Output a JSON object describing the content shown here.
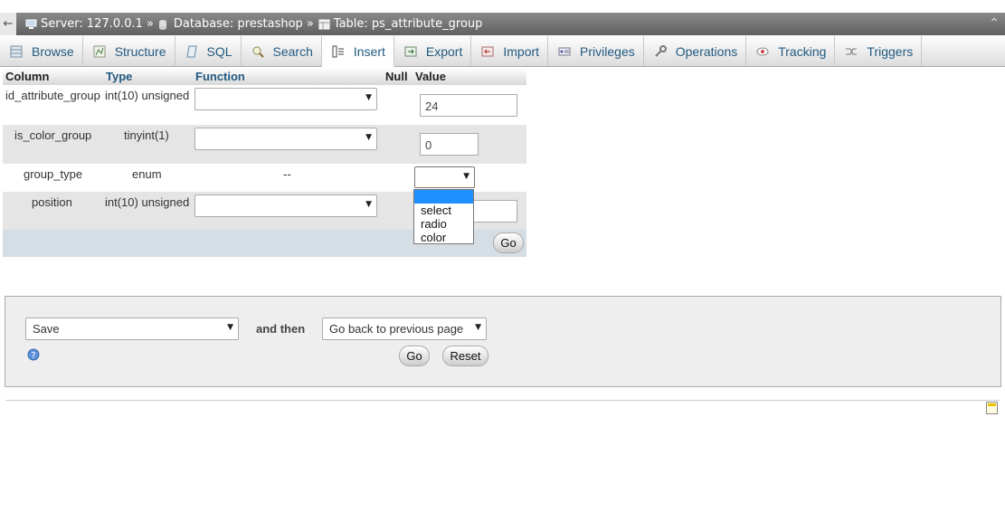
{
  "breadcrumb": {
    "back": "←",
    "server": "Server: 127.0.0.1",
    "database": "Database: prestashop",
    "table": "Table: ps_attribute_group",
    "separator": "»",
    "collapse": "⌃"
  },
  "tabs": [
    {
      "label": "Browse",
      "icon": "browse-icon"
    },
    {
      "label": "Structure",
      "icon": "structure-icon"
    },
    {
      "label": "SQL",
      "icon": "sql-icon"
    },
    {
      "label": "Search",
      "icon": "search-icon"
    },
    {
      "label": "Insert",
      "icon": "insert-icon",
      "active": true
    },
    {
      "label": "Export",
      "icon": "export-icon"
    },
    {
      "label": "Import",
      "icon": "import-icon"
    },
    {
      "label": "Privileges",
      "icon": "privileges-icon"
    },
    {
      "label": "Operations",
      "icon": "operations-icon"
    },
    {
      "label": "Tracking",
      "icon": "tracking-icon"
    },
    {
      "label": "Triggers",
      "icon": "triggers-icon"
    }
  ],
  "insert_table": {
    "headers": {
      "column": "Column",
      "type": "Type",
      "function": "Function",
      "null": "Null",
      "value": "Value"
    },
    "rows": [
      {
        "column": "id_attribute_group",
        "type": "int(10) unsigned",
        "function": "",
        "value": "24"
      },
      {
        "column": "is_color_group",
        "type": "tinyint(1)",
        "function": "",
        "value": "0"
      },
      {
        "column": "group_type",
        "type": "enum",
        "function": "--",
        "value": ""
      },
      {
        "column": "position",
        "type": "int(10) unsigned",
        "function": "",
        "value": ""
      }
    ],
    "enum_options": [
      "",
      "select",
      "radio",
      "color"
    ],
    "go_label": "Go"
  },
  "footer_form": {
    "action_value": "Save",
    "and_then": "and then",
    "after_value": "Go back to previous page",
    "go_label": "Go",
    "reset_label": "Reset"
  },
  "colors": {
    "link": "#235a81",
    "highlight": "#1e90ff",
    "row_alt": "#e5e5e5",
    "panel": "#eeeeee"
  }
}
